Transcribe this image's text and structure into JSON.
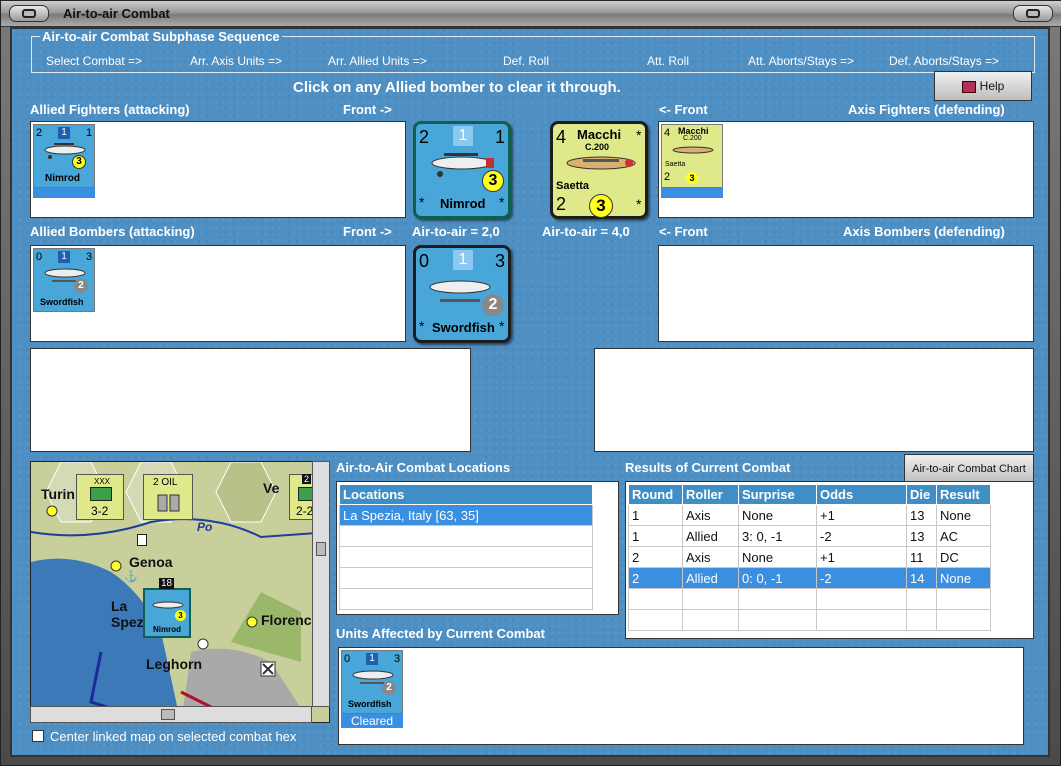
{
  "window": {
    "title": "Air-to-air Combat"
  },
  "sequence": {
    "title": "Air-to-air Combat Subphase Sequence",
    "steps": [
      "Select Combat =>",
      "Arr. Axis Units =>",
      "Arr. Allied Units =>",
      "Def. Roll",
      "Att. Roll",
      "Att. Aborts/Stays =>",
      "Def. Aborts/Stays =>"
    ]
  },
  "instruction": "Click on any Allied bomber to clear it through.",
  "help_button": "Help",
  "labels": {
    "allied_fighters": "Allied Fighters (attacking)",
    "front_right_1": "Front ->",
    "front_left_1": "<- Front",
    "axis_fighters": "Axis Fighters (defending)",
    "allied_bombers": "Allied Bombers (attacking)",
    "front_right_2": "Front ->",
    "front_left_2": "<- Front",
    "axis_bombers": "Axis Bombers (defending)",
    "air_to_air_allied": "Air-to-air = 2,0",
    "air_to_air_axis": "Air-to-air = 4,0"
  },
  "units": {
    "nimrod": {
      "name": "Nimrod",
      "left": "2",
      "top": "1",
      "right": "1",
      "circle": "3",
      "star": "*"
    },
    "swordfish": {
      "name": "Swordfish",
      "left": "0",
      "top": "1",
      "right": "3",
      "circle": "2",
      "star": "*"
    },
    "macchi": {
      "name": "Macchi",
      "sub": "C.200",
      "nick": "Saetta",
      "left": "4",
      "bottom_left": "2",
      "circle": "3",
      "star": "*"
    },
    "macchi_small_name": "Macchi",
    "macchi_small_sub": "C.200"
  },
  "map": {
    "cities": [
      "Turin",
      "Genoa",
      "La Spezia",
      "Florence",
      "Leghorn",
      "Ve"
    ],
    "river": "Po",
    "counters": {
      "oil": "2 OIL",
      "infantry": "3-2",
      "infantry2": "2-2",
      "stack": "18",
      "stack2": "2",
      "xxx": "XXX"
    },
    "center_checkbox": "Center linked map on selected combat hex"
  },
  "locations": {
    "title": "Air-to-Air Combat Locations",
    "header": "Locations",
    "rows": [
      "La Spezia, Italy [63, 35]"
    ]
  },
  "results": {
    "title": "Results of Current Combat",
    "chart_button": "Air-to-air Combat Chart",
    "headers": [
      "Round",
      "Roller",
      "Surprise",
      "Odds",
      "Die",
      "Result"
    ],
    "rows": [
      [
        "1",
        "Axis",
        "None",
        "+1",
        "13",
        "None"
      ],
      [
        "1",
        "Allied",
        "3: 0, -1",
        "-2",
        "13",
        "AC"
      ],
      [
        "2",
        "Axis",
        "None",
        "+1",
        "11",
        "DC"
      ],
      [
        "2",
        "Allied",
        "0: 0, -1",
        "-2",
        "14",
        "None"
      ]
    ]
  },
  "affected": {
    "title": "Units Affected by Current Combat",
    "cleared": "Cleared"
  },
  "colors": {
    "background": "#4e8fc3",
    "counter_blue": "#49a6d9",
    "counter_yellow": "#dfe98a",
    "selection": "#3a8fe0"
  }
}
